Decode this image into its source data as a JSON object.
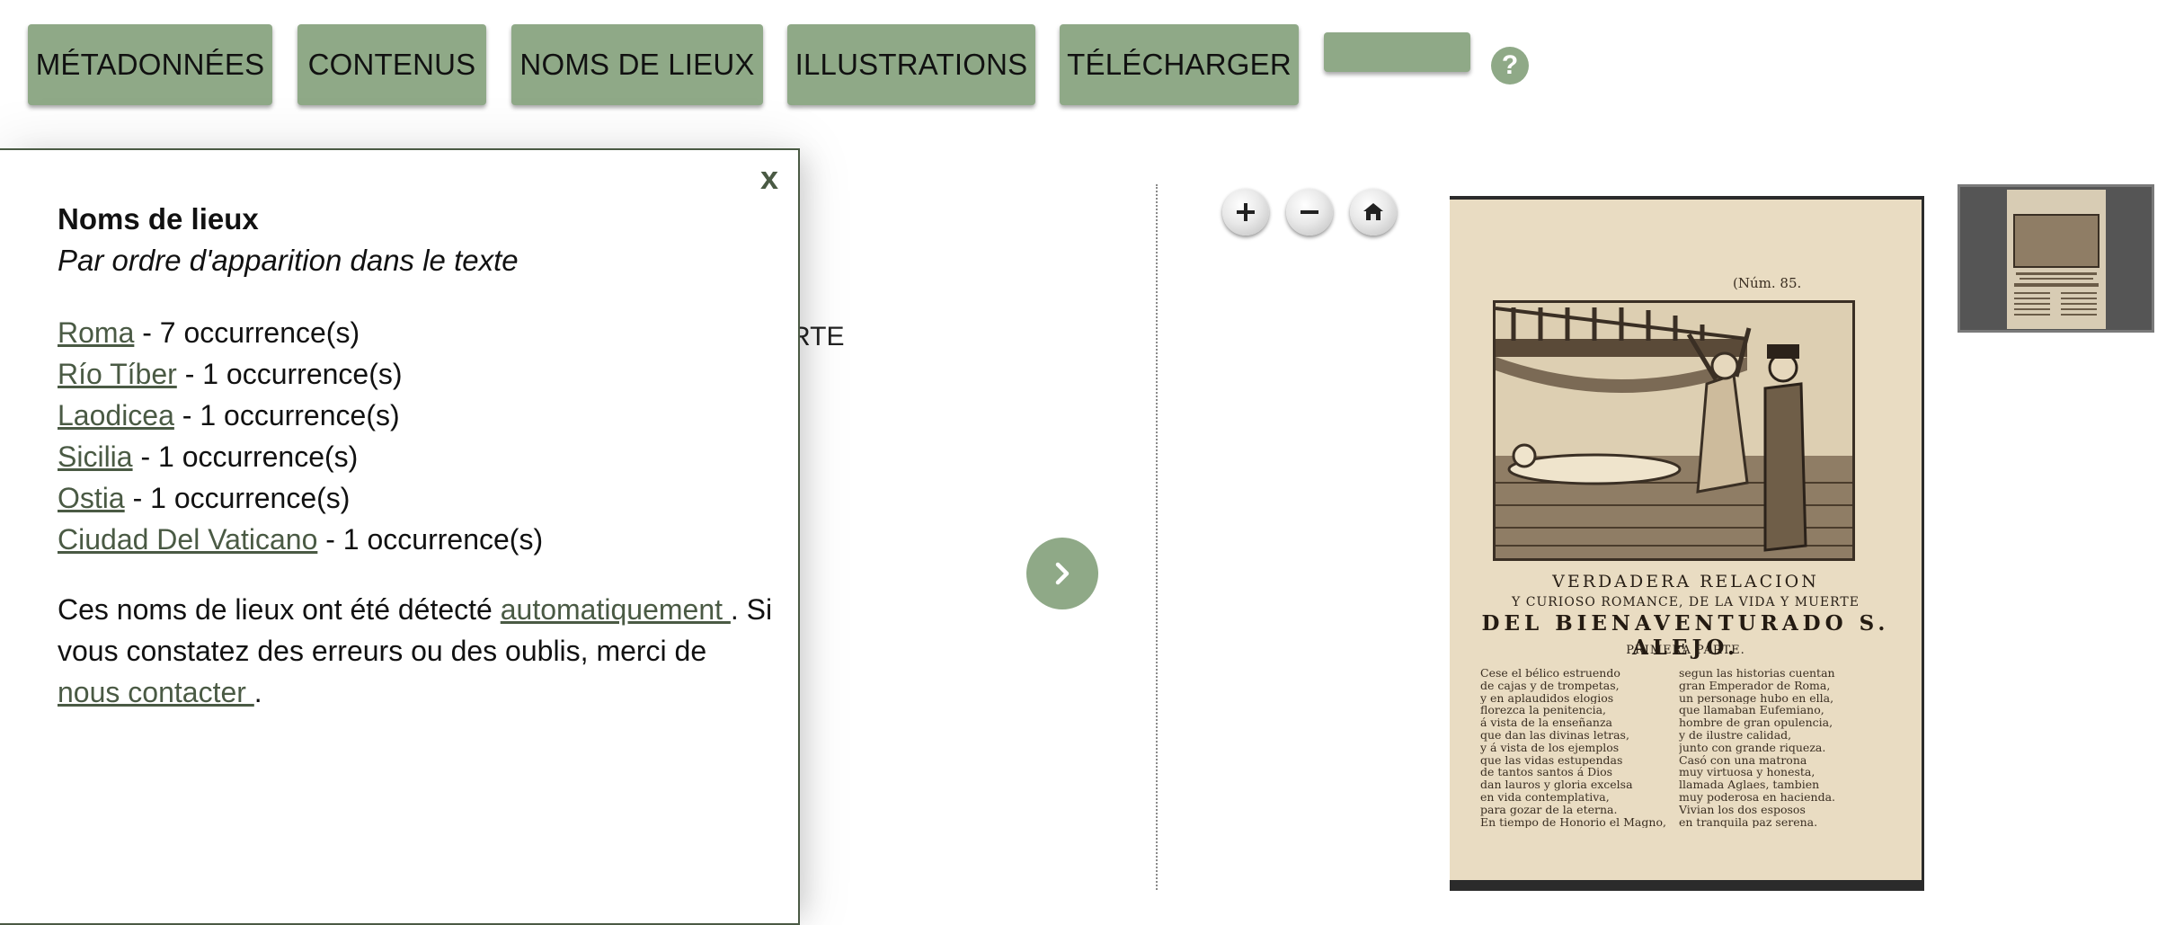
{
  "toolbar": {
    "buttons": [
      {
        "label": "MÉTADONNÉES"
      },
      {
        "label": "CONTENUS"
      },
      {
        "label": "NOMS DE LIEUX"
      },
      {
        "label": "ILLUSTRATIONS"
      },
      {
        "label": "TÉLÉCHARGER"
      },
      {
        "label": ""
      }
    ],
    "help_glyph": "?"
  },
  "background_fragment": "RTE",
  "popup": {
    "close_label": "x",
    "title": "Noms de lieux",
    "subtitle": "Par ordre d'apparition dans le texte",
    "places": [
      {
        "name": "Roma",
        "count_text": " - 7 occurrence(s)"
      },
      {
        "name": "Río Tíber",
        "count_text": " - 1 occurrence(s)"
      },
      {
        "name": "Laodicea",
        "count_text": " - 1 occurrence(s)"
      },
      {
        "name": "Sicilia",
        "count_text": " - 1 occurrence(s)"
      },
      {
        "name": "Ostia",
        "count_text": " - 1 occurrence(s)"
      },
      {
        "name": "Ciudad Del Vaticano",
        "count_text": " - 1 occurrence(s)"
      }
    ],
    "note_part1": "Ces noms de lieux ont été détecté ",
    "note_link1": "automatiquement ",
    "note_part2": ". Si vous constatez des erreurs ou des oublis, merci de ",
    "note_link2": "nous contacter ",
    "note_part3": "."
  },
  "viewer": {
    "controls": [
      "zoom-in-icon",
      "zoom-out-icon",
      "home-icon"
    ],
    "next_icon": "chevron-right-icon",
    "colors": {
      "accent": "#8fa987",
      "link": "#4a5a44",
      "paper": "#e9dcc2"
    },
    "document": {
      "number": "(Núm. 85.",
      "heading1": "VERDADERA RELACION",
      "heading2": "Y CURIOSO ROMANCE, DE LA VIDA Y MUERTE",
      "heading3": "DEL BIENAVENTURADO S. ALEJO.",
      "heading4": "PRIMERA PARTE.",
      "column_left": [
        "Cese el bélico estruendo",
        "de cajas y de trompetas,",
        "y en aplaudidos elogios",
        "florezca la penitencia,",
        "á vista de la enseñanza",
        "que dan las divinas letras,",
        "y á vista de los ejemplos",
        "que las vidas estupendas",
        "de tantos santos á Dios",
        "dan lauros y gloria excelsa",
        "en vida contemplativa,",
        "para gozar de la eterna.",
        "En tiempo de Honorio el Magno,"
      ],
      "column_right": [
        "segun las historias cuentan",
        "gran Emperador de Roma,",
        "un personage hubo en ella,",
        "que llamaban Eufemiano,",
        "hombre de gran opulencia,",
        "y de ilustre calidad,",
        "junto con grande riqueza.",
        "Casó con una matrona",
        "muy virtuosa y honesta,",
        "llamada Aglaes, tambien",
        "muy poderosa en hacienda.",
        "Vivian los dos esposos",
        "en tranquila paz serena."
      ]
    }
  }
}
